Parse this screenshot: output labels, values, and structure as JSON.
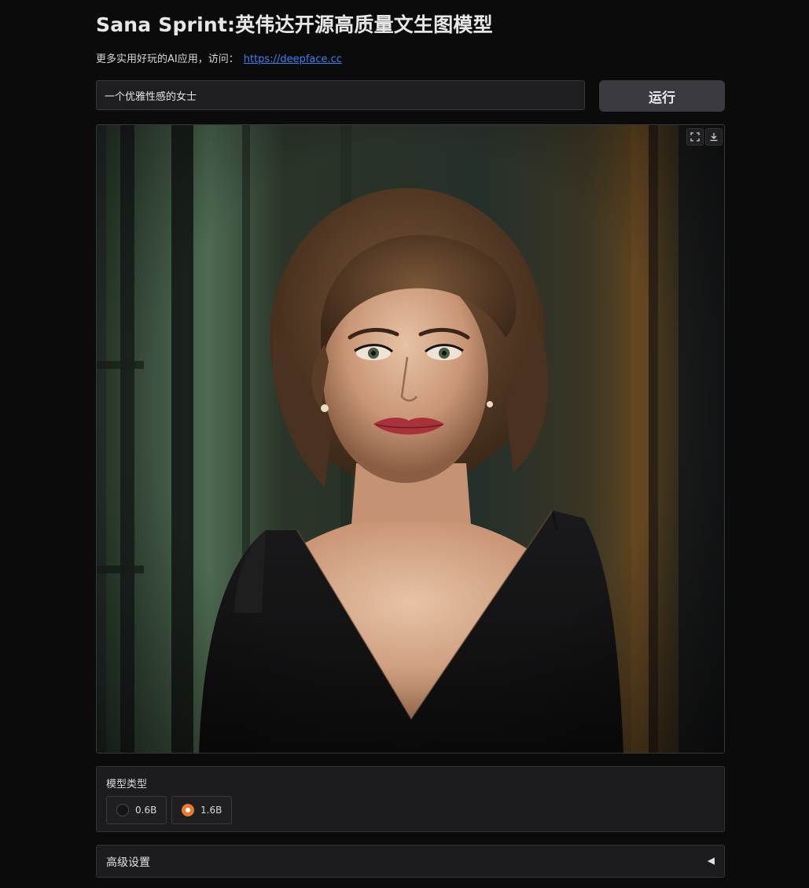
{
  "header": {
    "title": "Sana Sprint:英伟达开源高质量文生图模型",
    "subtitle_prefix": "更多实用好玩的AI应用，访问：",
    "subtitle_link": "https://deepface.cc"
  },
  "prompt": {
    "value": "一个优雅性感的女士",
    "placeholder": ""
  },
  "run_button": {
    "label": "运行"
  },
  "image_panel": {
    "tools": [
      "fullscreen-icon",
      "download-icon"
    ]
  },
  "model_type": {
    "label": "模型类型",
    "options": [
      {
        "label": "0.6B",
        "selected": false
      },
      {
        "label": "1.6B",
        "selected": true
      }
    ]
  },
  "advanced": {
    "label": "高级设置",
    "arrow": "◀"
  },
  "colors": {
    "background": "#0b0b0c",
    "accent": "#ea7b33",
    "link": "#3b82f6"
  }
}
